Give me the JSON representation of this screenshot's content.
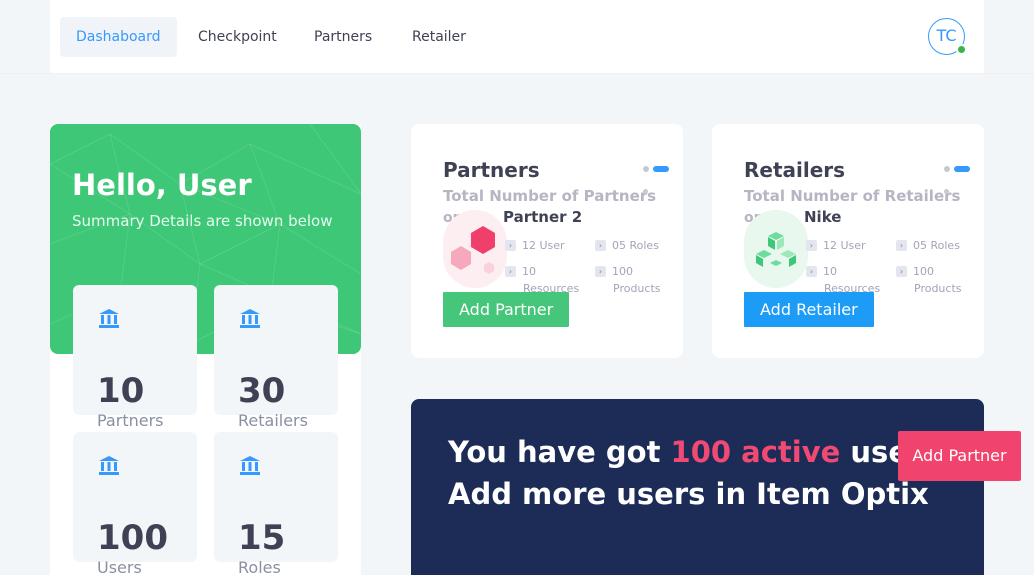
{
  "nav": {
    "items": [
      {
        "label": "Dashaboard",
        "active": true
      },
      {
        "label": "Checkpoint",
        "active": false
      },
      {
        "label": "Partners",
        "active": false
      },
      {
        "label": "Retailer",
        "active": false
      }
    ],
    "avatar_initials": "TC",
    "online_color": "#3bb54a"
  },
  "hello": {
    "title": "Hello, User",
    "subtitle": "Summary Details are shown below",
    "color": "#3ec777"
  },
  "stats": [
    {
      "icon": "bank-icon",
      "value": "10",
      "label": "Partners"
    },
    {
      "icon": "bank-icon",
      "value": "30",
      "label": "Retailers"
    },
    {
      "icon": "bank-icon",
      "value": "100",
      "label": "Users"
    },
    {
      "icon": "bank-icon",
      "value": "15",
      "label": "Roles"
    }
  ],
  "partners_card": {
    "title": "Partners",
    "subtitle": "Total Number of Partners",
    "subtitle2": "or",
    "item": {
      "name": "Partner 2",
      "icon": "hexagon-logo-icon",
      "users": "12 User",
      "roles": "05 Roles",
      "resources_value": "10",
      "resources_label": "Resources",
      "products_value": "100",
      "products_label": "Products"
    },
    "button": "Add Partner",
    "button_color": "#45c67a"
  },
  "retailers_card": {
    "title": "Retailers",
    "subtitle": "Total Number of Retailers",
    "subtitle2": "or",
    "item": {
      "name": "Nike",
      "icon": "cubes-logo-icon",
      "users": "12 User",
      "roles": "05 Roles",
      "resources_value": "10",
      "resources_label": "Resources",
      "products_value": "100",
      "products_label": "Products"
    },
    "button": "Add Retailer",
    "button_color": "#1c9cf6"
  },
  "banner": {
    "line1_pre": "You have got ",
    "line1_highlight": "100 active",
    "line1_post": " users.",
    "line2": "Add more users in Item Optix",
    "button": "Add Partner",
    "bg_color": "#1c2c57",
    "highlight_color": "#f04a74"
  }
}
